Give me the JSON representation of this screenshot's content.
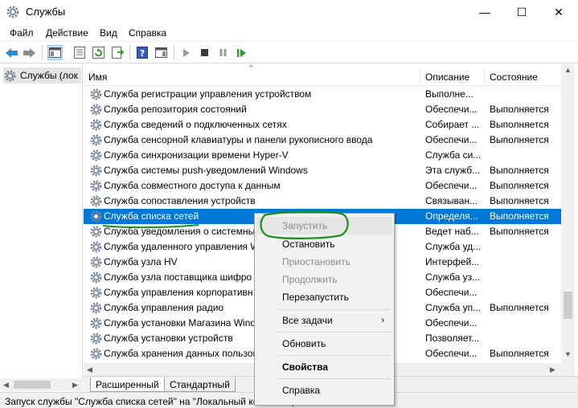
{
  "window": {
    "title": "Службы",
    "minimize": "—",
    "maximize": "☐",
    "close": "✕"
  },
  "menu": [
    "Файл",
    "Действие",
    "Вид",
    "Справка"
  ],
  "tree": {
    "item": "Службы (лок"
  },
  "columns": {
    "name": "Имя",
    "description": "Описание",
    "state": "Состояние"
  },
  "rows": [
    {
      "name": "Служба регистрации управления устройством",
      "desc": "Выполне...",
      "state": ""
    },
    {
      "name": "Служба репозитория состояний",
      "desc": "Обеспечи...",
      "state": "Выполняется"
    },
    {
      "name": "Служба сведений о подключенных сетях",
      "desc": "Собирает ...",
      "state": "Выполняется"
    },
    {
      "name": "Служба сенсорной клавиатуры и панели рукописного ввода",
      "desc": "Обеспечи...",
      "state": "Выполняется"
    },
    {
      "name": "Служба синхронизации времени Hyper-V",
      "desc": "Служба си...",
      "state": ""
    },
    {
      "name": "Служба системы push-уведомлений Windows",
      "desc": "Эта служб...",
      "state": "Выполняется"
    },
    {
      "name": "Служба совместного доступа к данным",
      "desc": "Обеспечи...",
      "state": "Выполняется"
    },
    {
      "name": "Служба сопоставления устройств",
      "desc": "Связыван...",
      "state": "Выполняется"
    },
    {
      "name": "Служба списка сетей",
      "desc": "Определя...",
      "state": "Выполняется"
    },
    {
      "name": "Служба уведомления о системны",
      "desc": "Ведет наб...",
      "state": "Выполняется"
    },
    {
      "name": "Служба удаленного управления W",
      "desc": "Служба уд...",
      "state": ""
    },
    {
      "name": "Служба узла HV",
      "desc": "Интерфей...",
      "state": ""
    },
    {
      "name": "Служба узла поставщика шифро",
      "desc": "Служба уз...",
      "state": ""
    },
    {
      "name": "Служба управления корпоративн",
      "desc": "Обеспечи...",
      "state": ""
    },
    {
      "name": "Служба управления радио",
      "desc": "Служба уп...",
      "state": "Выполняется"
    },
    {
      "name": "Служба установки Магазина Wind",
      "desc": "Обеспечи...",
      "state": ""
    },
    {
      "name": "Служба установки устройств",
      "desc": "Позволяет...",
      "state": ""
    },
    {
      "name": "Служба хранения данных пользов",
      "desc": "Обеспечи...",
      "state": "Выполняется"
    }
  ],
  "context_menu": {
    "start": "Запустить",
    "stop": "Остановить",
    "pause": "Приостановить",
    "resume": "Продолжить",
    "restart": "Перезапустить",
    "all_tasks": "Все задачи",
    "refresh": "Обновить",
    "properties": "Свойства",
    "help": "Справка"
  },
  "tabs": {
    "extended": "Расширенный",
    "standard": "Стандартный"
  },
  "status": "Запуск службы \"Служба списка сетей\" на \"Локальный компьютер\"",
  "colors": {
    "selection": "#0078d7",
    "annotation": "#1a8f1a"
  }
}
